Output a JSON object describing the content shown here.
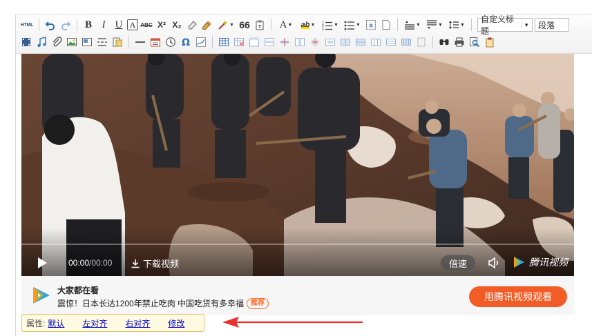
{
  "toolbar": {
    "row1": [
      {
        "name": "html-source-button",
        "label": "HTML"
      },
      {
        "name": "undo-button",
        "icon": "undo-icon"
      },
      {
        "name": "redo-button",
        "icon": "redo-icon"
      },
      {
        "name": "bold-button",
        "label": "B"
      },
      {
        "name": "italic-button",
        "label": "I"
      },
      {
        "name": "underline-button",
        "label": "U"
      },
      {
        "name": "font-border-button",
        "label": "A"
      },
      {
        "name": "strikethrough-button",
        "label": "ABC"
      },
      {
        "name": "superscript-button",
        "label": "X²"
      },
      {
        "name": "subscript-button",
        "label": "X₂"
      },
      {
        "name": "format-clear-button",
        "icon": "eraser-icon"
      },
      {
        "name": "format-painter-button",
        "icon": "brush-icon"
      },
      {
        "name": "auto-typeset-button",
        "icon": "magic-wand-icon"
      },
      {
        "name": "blockquote-button",
        "label": "66"
      },
      {
        "name": "paste-plain-button",
        "icon": "clipboard-text-icon"
      },
      {
        "name": "font-color-button",
        "label": "A"
      },
      {
        "name": "highlight-color-button",
        "label": "ab"
      },
      {
        "name": "ordered-list-button",
        "icon": "ordered-list-icon"
      },
      {
        "name": "unordered-list-button",
        "icon": "unordered-list-icon"
      },
      {
        "name": "select-all-button",
        "icon": "select-all-icon"
      },
      {
        "name": "clear-doc-button",
        "icon": "blank-page-icon"
      },
      {
        "name": "row-spacing-top-button",
        "icon": "spacing-top-icon"
      },
      {
        "name": "row-spacing-bottom-button",
        "icon": "spacing-bottom-icon"
      },
      {
        "name": "line-height-button",
        "icon": "line-height-icon"
      }
    ],
    "custom_title_label": "自定义标题",
    "paragraph_label": "段落",
    "row2": [
      {
        "name": "insert-video-icon"
      },
      {
        "name": "insert-music-icon"
      },
      {
        "name": "attachment-icon"
      },
      {
        "name": "insert-image-icon"
      },
      {
        "name": "insert-frame-icon"
      },
      {
        "name": "pagebreak-icon"
      },
      {
        "name": "template-icon"
      },
      {
        "name": "horizontal-rule-icon"
      },
      {
        "name": "date-icon"
      },
      {
        "name": "time-icon"
      },
      {
        "name": "special-char-icon"
      },
      {
        "name": "scrawl-icon"
      },
      {
        "name": "insert-table-icon"
      },
      {
        "name": "delete-table-icon"
      },
      {
        "name": "insert-caption-icon"
      },
      {
        "name": "insert-row-icon"
      },
      {
        "name": "delete-row-icon"
      },
      {
        "name": "insert-col-icon"
      },
      {
        "name": "delete-col-icon"
      },
      {
        "name": "merge-cells-icon"
      },
      {
        "name": "merge-right-icon"
      },
      {
        "name": "merge-down-icon"
      },
      {
        "name": "split-cells-icon"
      },
      {
        "name": "split-rows-icon"
      },
      {
        "name": "split-cols-icon"
      },
      {
        "name": "paste-table-icon"
      },
      {
        "name": "search-replace-icon"
      },
      {
        "name": "print-icon"
      },
      {
        "name": "preview-icon"
      },
      {
        "name": "drafts-icon"
      }
    ]
  },
  "video": {
    "current_time": "00:00",
    "separator": "/",
    "duration": "00:00",
    "download_label": "下载视频",
    "speed_label": "倍速",
    "brand_label": "腾讯视频",
    "progress_fraction": 0
  },
  "recommend": {
    "title": "大家都在看",
    "description": "震惊！日本长达1200年禁止吃肉 中国吃货有多幸福",
    "tag": "推荐",
    "watch_button": "用腾讯视频观看"
  },
  "properties": {
    "label": "属性:",
    "links": [
      "默认",
      "左对齐",
      "右对齐",
      "修改"
    ]
  },
  "colors": {
    "accent_orange": "#f25c27",
    "link_blue": "#0000cc",
    "annotation_red": "#e8312f",
    "props_bg": "#fffbe3"
  }
}
